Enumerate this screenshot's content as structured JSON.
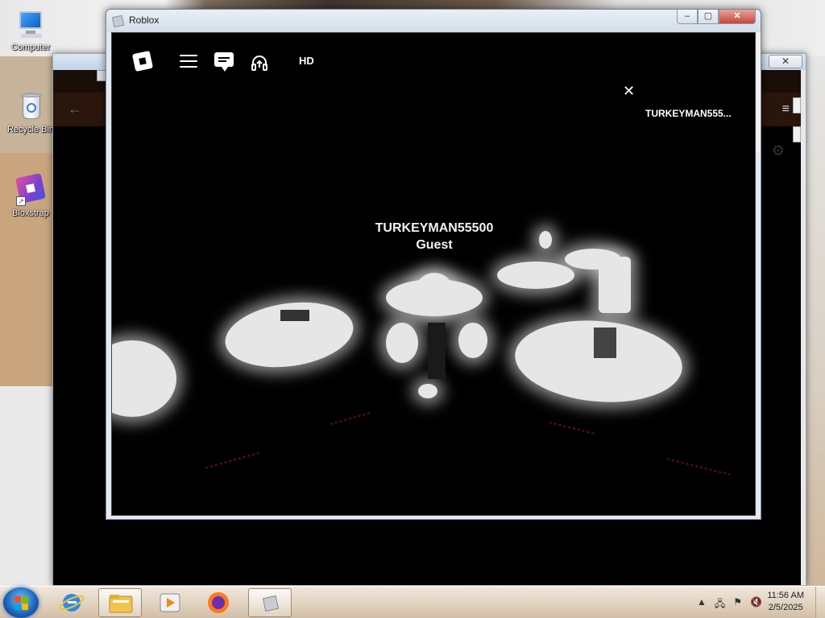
{
  "desktop": {
    "icons": [
      {
        "label": "Computer"
      },
      {
        "label": "Recycle Bin"
      },
      {
        "label": "Bloxstrap"
      }
    ]
  },
  "background_window": {
    "close_glyph": "✕",
    "back_glyph": "←",
    "menu_glyph": "≡",
    "gear_glyph": "⚙"
  },
  "roblox_window": {
    "title": "Roblox",
    "buttons": {
      "minimize": "–",
      "maximize": "▢",
      "close": "✕"
    }
  },
  "game": {
    "topbar": {
      "hd_label": "HD",
      "close_glyph": "✕",
      "player_name_short": "TURKEYMAN555..."
    },
    "nametag": {
      "name": "TURKEYMAN55500",
      "rank": "Guest"
    }
  },
  "taskbar": {
    "clock_time": "11:56 AM",
    "clock_date": "2/5/2025",
    "tray_arrow": "▲"
  },
  "colors": {
    "game_bg": "#000000",
    "glow": "#e6e6e6",
    "taskbar": "#e1d2bf",
    "start_orb": "#1c5fb4"
  }
}
